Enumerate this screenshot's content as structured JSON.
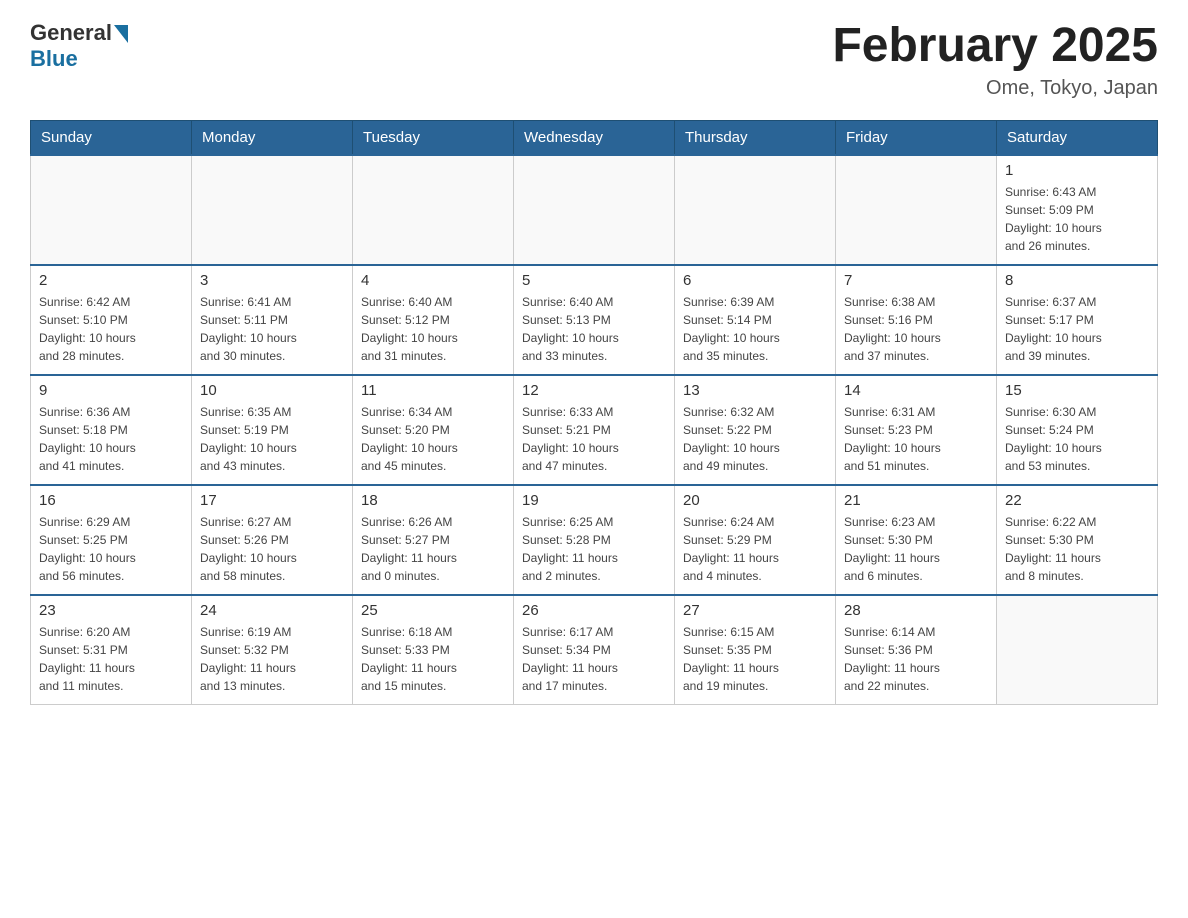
{
  "header": {
    "logo_general": "General",
    "logo_blue": "Blue",
    "title": "February 2025",
    "subtitle": "Ome, Tokyo, Japan"
  },
  "days_of_week": [
    "Sunday",
    "Monday",
    "Tuesday",
    "Wednesday",
    "Thursday",
    "Friday",
    "Saturday"
  ],
  "weeks": [
    [
      {
        "day": "",
        "info": ""
      },
      {
        "day": "",
        "info": ""
      },
      {
        "day": "",
        "info": ""
      },
      {
        "day": "",
        "info": ""
      },
      {
        "day": "",
        "info": ""
      },
      {
        "day": "",
        "info": ""
      },
      {
        "day": "1",
        "info": "Sunrise: 6:43 AM\nSunset: 5:09 PM\nDaylight: 10 hours\nand 26 minutes."
      }
    ],
    [
      {
        "day": "2",
        "info": "Sunrise: 6:42 AM\nSunset: 5:10 PM\nDaylight: 10 hours\nand 28 minutes."
      },
      {
        "day": "3",
        "info": "Sunrise: 6:41 AM\nSunset: 5:11 PM\nDaylight: 10 hours\nand 30 minutes."
      },
      {
        "day": "4",
        "info": "Sunrise: 6:40 AM\nSunset: 5:12 PM\nDaylight: 10 hours\nand 31 minutes."
      },
      {
        "day": "5",
        "info": "Sunrise: 6:40 AM\nSunset: 5:13 PM\nDaylight: 10 hours\nand 33 minutes."
      },
      {
        "day": "6",
        "info": "Sunrise: 6:39 AM\nSunset: 5:14 PM\nDaylight: 10 hours\nand 35 minutes."
      },
      {
        "day": "7",
        "info": "Sunrise: 6:38 AM\nSunset: 5:16 PM\nDaylight: 10 hours\nand 37 minutes."
      },
      {
        "day": "8",
        "info": "Sunrise: 6:37 AM\nSunset: 5:17 PM\nDaylight: 10 hours\nand 39 minutes."
      }
    ],
    [
      {
        "day": "9",
        "info": "Sunrise: 6:36 AM\nSunset: 5:18 PM\nDaylight: 10 hours\nand 41 minutes."
      },
      {
        "day": "10",
        "info": "Sunrise: 6:35 AM\nSunset: 5:19 PM\nDaylight: 10 hours\nand 43 minutes."
      },
      {
        "day": "11",
        "info": "Sunrise: 6:34 AM\nSunset: 5:20 PM\nDaylight: 10 hours\nand 45 minutes."
      },
      {
        "day": "12",
        "info": "Sunrise: 6:33 AM\nSunset: 5:21 PM\nDaylight: 10 hours\nand 47 minutes."
      },
      {
        "day": "13",
        "info": "Sunrise: 6:32 AM\nSunset: 5:22 PM\nDaylight: 10 hours\nand 49 minutes."
      },
      {
        "day": "14",
        "info": "Sunrise: 6:31 AM\nSunset: 5:23 PM\nDaylight: 10 hours\nand 51 minutes."
      },
      {
        "day": "15",
        "info": "Sunrise: 6:30 AM\nSunset: 5:24 PM\nDaylight: 10 hours\nand 53 minutes."
      }
    ],
    [
      {
        "day": "16",
        "info": "Sunrise: 6:29 AM\nSunset: 5:25 PM\nDaylight: 10 hours\nand 56 minutes."
      },
      {
        "day": "17",
        "info": "Sunrise: 6:27 AM\nSunset: 5:26 PM\nDaylight: 10 hours\nand 58 minutes."
      },
      {
        "day": "18",
        "info": "Sunrise: 6:26 AM\nSunset: 5:27 PM\nDaylight: 11 hours\nand 0 minutes."
      },
      {
        "day": "19",
        "info": "Sunrise: 6:25 AM\nSunset: 5:28 PM\nDaylight: 11 hours\nand 2 minutes."
      },
      {
        "day": "20",
        "info": "Sunrise: 6:24 AM\nSunset: 5:29 PM\nDaylight: 11 hours\nand 4 minutes."
      },
      {
        "day": "21",
        "info": "Sunrise: 6:23 AM\nSunset: 5:30 PM\nDaylight: 11 hours\nand 6 minutes."
      },
      {
        "day": "22",
        "info": "Sunrise: 6:22 AM\nSunset: 5:30 PM\nDaylight: 11 hours\nand 8 minutes."
      }
    ],
    [
      {
        "day": "23",
        "info": "Sunrise: 6:20 AM\nSunset: 5:31 PM\nDaylight: 11 hours\nand 11 minutes."
      },
      {
        "day": "24",
        "info": "Sunrise: 6:19 AM\nSunset: 5:32 PM\nDaylight: 11 hours\nand 13 minutes."
      },
      {
        "day": "25",
        "info": "Sunrise: 6:18 AM\nSunset: 5:33 PM\nDaylight: 11 hours\nand 15 minutes."
      },
      {
        "day": "26",
        "info": "Sunrise: 6:17 AM\nSunset: 5:34 PM\nDaylight: 11 hours\nand 17 minutes."
      },
      {
        "day": "27",
        "info": "Sunrise: 6:15 AM\nSunset: 5:35 PM\nDaylight: 11 hours\nand 19 minutes."
      },
      {
        "day": "28",
        "info": "Sunrise: 6:14 AM\nSunset: 5:36 PM\nDaylight: 11 hours\nand 22 minutes."
      },
      {
        "day": "",
        "info": ""
      }
    ]
  ]
}
